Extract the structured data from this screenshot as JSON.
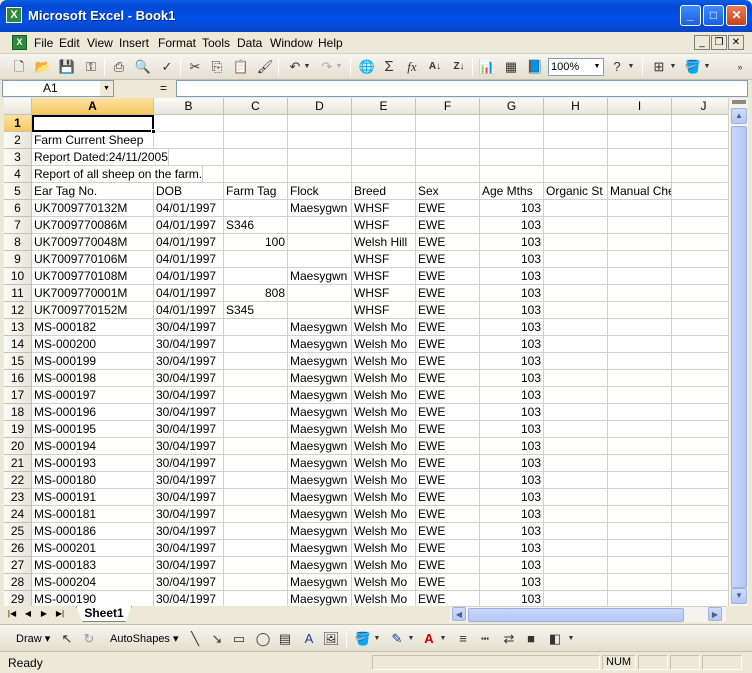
{
  "window": {
    "title": "Microsoft Excel - Book1",
    "app_icon": "X"
  },
  "menu": [
    "File",
    "Edit",
    "View",
    "Insert",
    "Format",
    "Tools",
    "Data",
    "Window",
    "Help"
  ],
  "toolbar": {
    "zoom": "100%"
  },
  "formula_bar": {
    "name_box": "A1",
    "equals": "=",
    "content": ""
  },
  "columns": [
    "A",
    "B",
    "C",
    "D",
    "E",
    "F",
    "G",
    "H",
    "I",
    "J"
  ],
  "sheet": {
    "active_cell": "A1",
    "tab_name": "Sheet1",
    "rows": [
      {
        "n": "1",
        "cells": [
          "",
          "",
          "",
          "",
          "",
          "",
          "",
          "",
          "",
          ""
        ]
      },
      {
        "n": "2",
        "cells": [
          "Farm Current Sheep",
          "",
          "",
          "",
          "",
          "",
          "",
          "",
          "",
          ""
        ]
      },
      {
        "n": "3",
        "cells": [
          "Report Dated:24/11/2005",
          "",
          "",
          "",
          "",
          "",
          "",
          "",
          "",
          ""
        ]
      },
      {
        "n": "4",
        "cells": [
          "Report of all sheep on the farm.",
          "",
          "",
          "",
          "",
          "",
          "",
          "",
          "",
          ""
        ]
      },
      {
        "n": "5",
        "cells": [
          "Ear Tag No.",
          "DOB",
          "Farm Tag",
          "Flock",
          "Breed",
          "Sex",
          "Age Mths",
          "Organic St",
          "Manual Check",
          ""
        ]
      },
      {
        "n": "6",
        "cells": [
          "UK7009770132M",
          "04/01/1997",
          "",
          "Maesygwn",
          "WHSF",
          "EWE",
          "103",
          "",
          "",
          ""
        ]
      },
      {
        "n": "7",
        "cells": [
          "UK7009770086M",
          "04/01/1997",
          "S346",
          "",
          "WHSF",
          "EWE",
          "103",
          "",
          "",
          ""
        ]
      },
      {
        "n": "8",
        "cells": [
          "UK7009770048M",
          "04/01/1997",
          "100",
          "",
          "Welsh Hill",
          "EWE",
          "103",
          "",
          "",
          ""
        ]
      },
      {
        "n": "9",
        "cells": [
          "UK7009770106M",
          "04/01/1997",
          "",
          "",
          "WHSF",
          "EWE",
          "103",
          "",
          "",
          ""
        ]
      },
      {
        "n": "10",
        "cells": [
          "UK7009770108M",
          "04/01/1997",
          "",
          "Maesygwn",
          "WHSF",
          "EWE",
          "103",
          "",
          "",
          ""
        ]
      },
      {
        "n": "11",
        "cells": [
          "UK7009770001M",
          "04/01/1997",
          "808",
          "",
          "WHSF",
          "EWE",
          "103",
          "",
          "",
          ""
        ]
      },
      {
        "n": "12",
        "cells": [
          "UK7009770152M",
          "04/01/1997",
          "S345",
          "",
          "WHSF",
          "EWE",
          "103",
          "",
          "",
          ""
        ]
      },
      {
        "n": "13",
        "cells": [
          "MS-000182",
          "30/04/1997",
          "",
          "Maesygwn",
          "Welsh Mo",
          "EWE",
          "103",
          "",
          "",
          ""
        ]
      },
      {
        "n": "14",
        "cells": [
          "MS-000200",
          "30/04/1997",
          "",
          "Maesygwn",
          "Welsh Mo",
          "EWE",
          "103",
          "",
          "",
          ""
        ]
      },
      {
        "n": "15",
        "cells": [
          "MS-000199",
          "30/04/1997",
          "",
          "Maesygwn",
          "Welsh Mo",
          "EWE",
          "103",
          "",
          "",
          ""
        ]
      },
      {
        "n": "16",
        "cells": [
          "MS-000198",
          "30/04/1997",
          "",
          "Maesygwn",
          "Welsh Mo",
          "EWE",
          "103",
          "",
          "",
          ""
        ]
      },
      {
        "n": "17",
        "cells": [
          "MS-000197",
          "30/04/1997",
          "",
          "Maesygwn",
          "Welsh Mo",
          "EWE",
          "103",
          "",
          "",
          ""
        ]
      },
      {
        "n": "18",
        "cells": [
          "MS-000196",
          "30/04/1997",
          "",
          "Maesygwn",
          "Welsh Mo",
          "EWE",
          "103",
          "",
          "",
          ""
        ]
      },
      {
        "n": "19",
        "cells": [
          "MS-000195",
          "30/04/1997",
          "",
          "Maesygwn",
          "Welsh Mo",
          "EWE",
          "103",
          "",
          "",
          ""
        ]
      },
      {
        "n": "20",
        "cells": [
          "MS-000194",
          "30/04/1997",
          "",
          "Maesygwn",
          "Welsh Mo",
          "EWE",
          "103",
          "",
          "",
          ""
        ]
      },
      {
        "n": "21",
        "cells": [
          "MS-000193",
          "30/04/1997",
          "",
          "Maesygwn",
          "Welsh Mo",
          "EWE",
          "103",
          "",
          "",
          ""
        ]
      },
      {
        "n": "22",
        "cells": [
          "MS-000180",
          "30/04/1997",
          "",
          "Maesygwn",
          "Welsh Mo",
          "EWE",
          "103",
          "",
          "",
          ""
        ]
      },
      {
        "n": "23",
        "cells": [
          "MS-000191",
          "30/04/1997",
          "",
          "Maesygwn",
          "Welsh Mo",
          "EWE",
          "103",
          "",
          "",
          ""
        ]
      },
      {
        "n": "24",
        "cells": [
          "MS-000181",
          "30/04/1997",
          "",
          "Maesygwn",
          "Welsh Mo",
          "EWE",
          "103",
          "",
          "",
          ""
        ]
      },
      {
        "n": "25",
        "cells": [
          "MS-000186",
          "30/04/1997",
          "",
          "Maesygwn",
          "Welsh Mo",
          "EWE",
          "103",
          "",
          "",
          ""
        ]
      },
      {
        "n": "26",
        "cells": [
          "MS-000201",
          "30/04/1997",
          "",
          "Maesygwn",
          "Welsh Mo",
          "EWE",
          "103",
          "",
          "",
          ""
        ]
      },
      {
        "n": "27",
        "cells": [
          "MS-000183",
          "30/04/1997",
          "",
          "Maesygwn",
          "Welsh Mo",
          "EWE",
          "103",
          "",
          "",
          ""
        ]
      },
      {
        "n": "28",
        "cells": [
          "MS-000204",
          "30/04/1997",
          "",
          "Maesygwn",
          "Welsh Mo",
          "EWE",
          "103",
          "",
          "",
          ""
        ]
      },
      {
        "n": "29",
        "cells": [
          "MS-000190",
          "30/04/1997",
          "",
          "Maesygwn",
          "Welsh Mo",
          "EWE",
          "103",
          "",
          "",
          ""
        ]
      }
    ]
  },
  "drawing_toolbar": {
    "draw_label": "Draw",
    "autoshapes_label": "AutoShapes"
  },
  "status_bar": {
    "status": "Ready",
    "num": "NUM"
  }
}
